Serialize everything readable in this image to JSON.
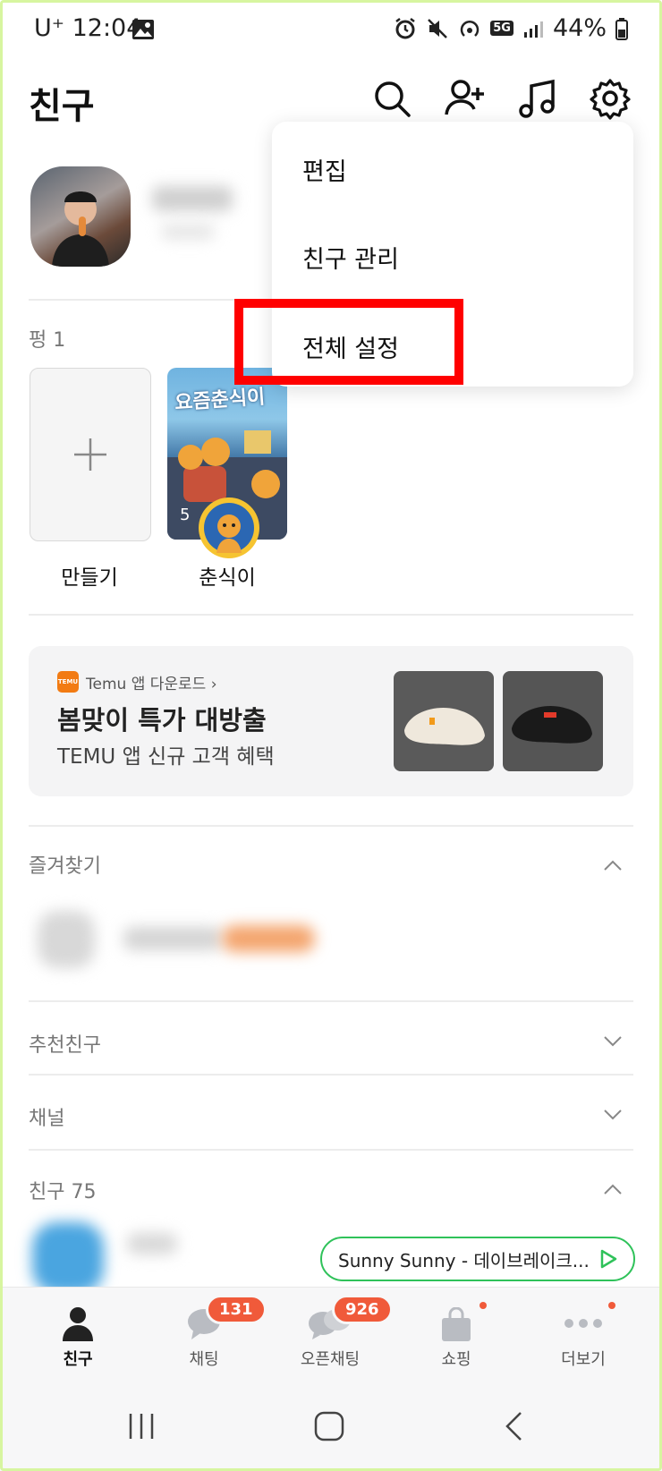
{
  "status_bar": {
    "carrier": "U⁺ 12:04",
    "battery": "44%",
    "network": "5G"
  },
  "header": {
    "title": "친구"
  },
  "menu": {
    "items": [
      "편집",
      "친구 관리",
      "전체 설정"
    ]
  },
  "stories": {
    "label": "펑 1",
    "create_label": "만들기",
    "story_name": "춘식이",
    "story_title_art": "요즘춘식이",
    "story_count": "5"
  },
  "ad": {
    "brand_icon_text": "TEMU",
    "brand_label": "Temu 앱 다운로드 ›",
    "headline": "봄맞이 특가 대방출",
    "subline": "TEMU 앱 신규 고객 혜택"
  },
  "sections": {
    "favorites": "즐겨찾기",
    "recommended": "추천친구",
    "channel": "채널",
    "friends": "친구 75"
  },
  "music": {
    "now_playing": "Sunny Sunny - 데이브레이크..."
  },
  "nav": {
    "friends": "친구",
    "chat": "채팅",
    "chat_badge": "131",
    "openchat": "오픈채팅",
    "openchat_badge": "926",
    "shopping": "쇼핑",
    "more": "더보기"
  },
  "colors": {
    "highlight": "#ff0000",
    "badge": "#f05a3a",
    "music_border": "#2fc25a",
    "temu_orange": "#f27b13"
  }
}
